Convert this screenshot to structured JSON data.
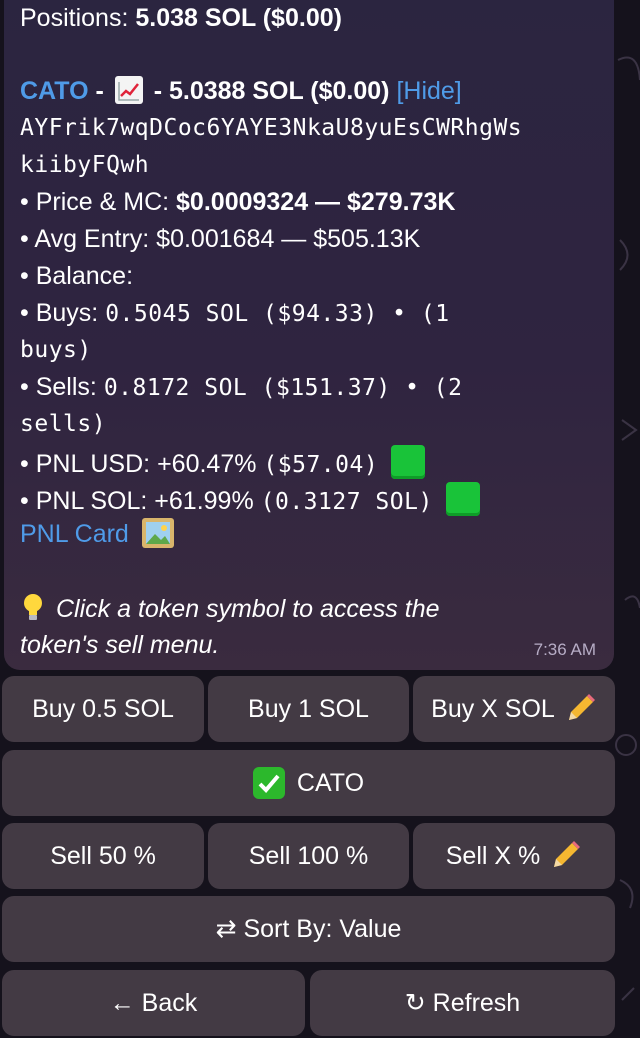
{
  "message": {
    "positions_label": "Positions:",
    "positions_value": "5.038 SOL ($0.00)",
    "token_symbol": "CATO",
    "sep1": " - ",
    "sep2": " - ",
    "token_value": "5.0388 SOL ($0.00)",
    "hide_link": "[Hide]",
    "address_line1": "AYFrik7wqDCoc6YAYE3NkaU8yuEsCWRhgWs",
    "address_line2": "kiibyFQwh",
    "bullet": "•",
    "price_label": "Price & MC:",
    "price_value": "$0.0009324 — $279.73K",
    "avg_label": "Avg Entry:",
    "avg_value": "$0.001684 — $505.13K",
    "balance_label": "Balance:",
    "buys_label": "Buys:",
    "buys_value": "0.5045 SOL ($94.33) • (1",
    "buys_cont": "buys)",
    "sells_label": "Sells:",
    "sells_value": "0.8172 SOL ($151.37) • (2",
    "sells_cont": "sells)",
    "pnl_usd_label": "PNL USD:",
    "pnl_usd_pct": "+60.47%",
    "pnl_usd_value": "($57.04)",
    "pnl_sol_label": "PNL SOL:",
    "pnl_sol_pct": "+61.99%",
    "pnl_sol_value": "(0.3127 SOL)",
    "pnl_card_link": "PNL Card",
    "hint_line1": "Click a token symbol to access the",
    "hint_line2": "token's sell menu.",
    "time": "7:36 AM"
  },
  "keyboard": {
    "buy_05": "Buy 0.5 SOL",
    "buy_1": "Buy 1 SOL",
    "buy_x": "Buy X SOL",
    "token": "CATO",
    "sell_50": "Sell 50 %",
    "sell_100": "Sell 100 %",
    "sell_x": "Sell X %",
    "sort": "⇄ Sort By: Value",
    "back": "← Back",
    "refresh": "↻ Refresh"
  },
  "icons": {
    "chart": "chart-increasing-icon",
    "picture": "framed-picture-icon",
    "bulb": "light-bulb-icon",
    "pencil": "pencil-icon",
    "check": "check-mark-button-icon",
    "status": "green-square-icon"
  },
  "colors": {
    "link": "#4f9be8",
    "green": "#19c339",
    "bubble": "#2b2540"
  }
}
